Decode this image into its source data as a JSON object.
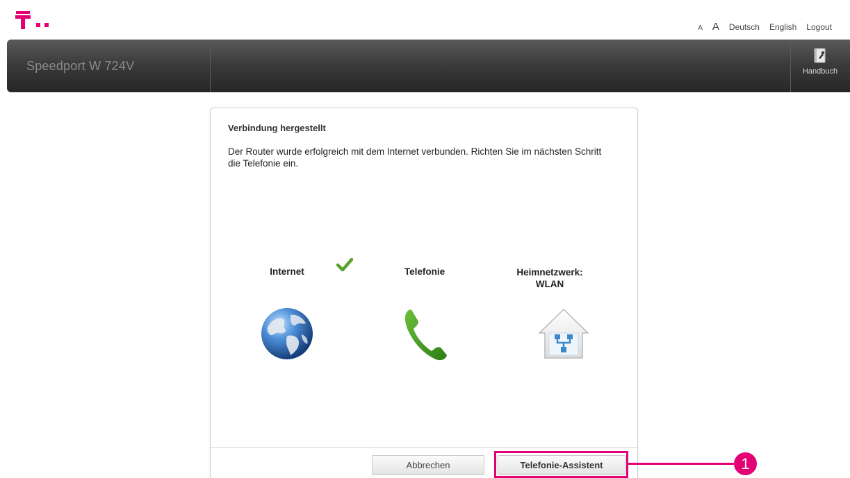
{
  "brand": {
    "logo": "telekom-t-logo",
    "accent_color": "#e20074"
  },
  "topnav": {
    "font_small": "A",
    "font_large": "A",
    "lang_de": "Deutsch",
    "lang_en": "English",
    "logout": "Logout"
  },
  "header": {
    "title": "Speedport W 724V",
    "handbuch_label": "Handbuch",
    "handbuch_icon": "manual-icon"
  },
  "panel": {
    "title": "Verbindung hergestellt",
    "text": "Der Router wurde erfolgreich mit dem Internet verbunden. Richten Sie im nächsten Schritt die Telefonie ein.",
    "steps": [
      {
        "label": "Internet",
        "icon": "globe-icon",
        "status": "done",
        "status_icon": "checkmark-icon"
      },
      {
        "label": "Telefonie",
        "icon": "phone-icon"
      },
      {
        "label_line1": "Heimnetzwerk:",
        "label_line2": "WLAN",
        "icon": "home-network-icon"
      }
    ],
    "buttons": {
      "cancel": "Abbrechen",
      "assistant": "Telefonie-Assistent"
    }
  },
  "callout": {
    "number": "1",
    "color": "#e20074"
  }
}
